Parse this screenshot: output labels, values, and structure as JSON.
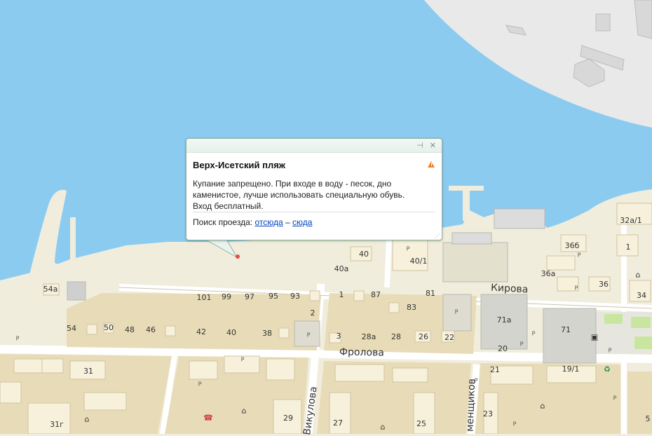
{
  "balloon": {
    "title": "Верх-Исетский пляж",
    "description": "Купание запрещено. При входе в воду - песок, дно каменистое, лучше использовать специальную обувь. Вход бесплатный.",
    "route_label": "Поиск проезда:",
    "route_from": "отсюда",
    "route_sep": "–",
    "route_to": "сюда",
    "pin_icon": "pin-icon",
    "close_icon": "close-icon",
    "warning_icon": "warning-icon"
  },
  "streets": {
    "kirova": "Кирова",
    "frolova": "Фролова",
    "vikulova": "Викулова",
    "kamentsikov": "менщиков"
  },
  "houses": {
    "h54a": "54а",
    "h101": "101",
    "h99": "99",
    "h97": "97",
    "h95": "95",
    "h93": "93",
    "h1": "1",
    "h87": "87",
    "h81": "81",
    "h2": "2",
    "h83": "83",
    "h54": "54",
    "h50": "50",
    "h48": "48",
    "h46": "46",
    "h42": "42",
    "h40s": "40",
    "h38": "38",
    "h3": "3",
    "h28a": "28а",
    "h28": "28",
    "h26": "26",
    "h22": "22",
    "h40": "40",
    "h40a": "40а",
    "h40_1": "40/1",
    "h36b": "36б",
    "h36a": "36а",
    "h36": "36",
    "h32a_1": "32а/1",
    "h1r": "1",
    "h34": "34",
    "h71a": "71а",
    "h71": "71",
    "h20": "20",
    "h21": "21",
    "h19_1": "19/1",
    "h31": "31",
    "h31g": "31г",
    "h29": "29",
    "h27": "27",
    "h25": "25",
    "h23": "23",
    "h5": "5"
  },
  "colors": {
    "water": "#8ccbf0",
    "land": "#f1eddc",
    "road": "#ffffff",
    "block": "#e8dcb8",
    "building": "#f7f1dc",
    "link": "#0044bb"
  }
}
